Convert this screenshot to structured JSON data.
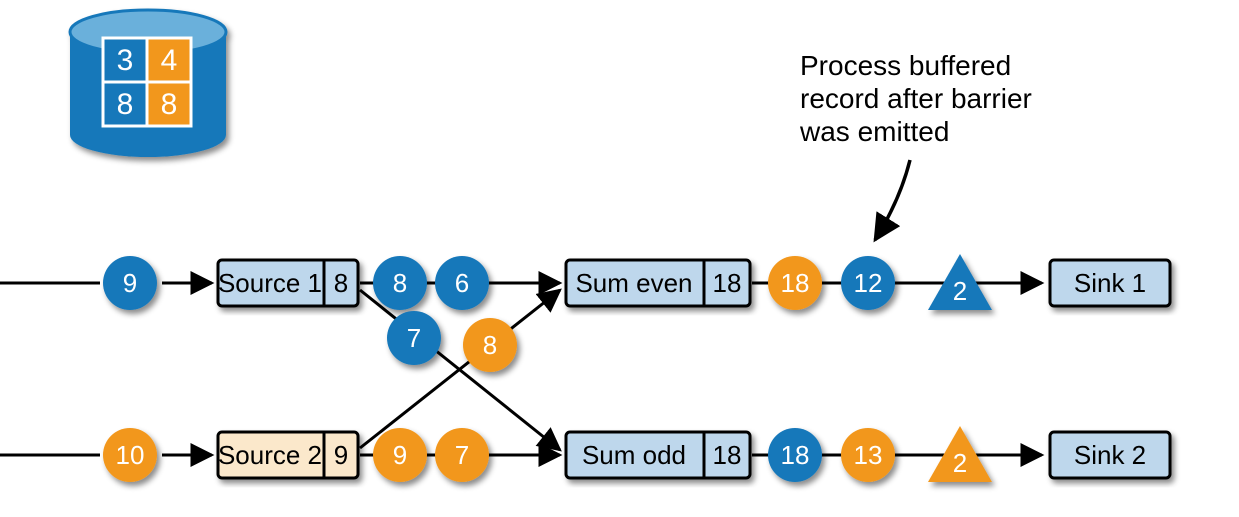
{
  "annotation": {
    "line1": "Process buffered",
    "line2": "record after barrier",
    "line3": "was emitted"
  },
  "state": {
    "tl": "3",
    "tr": "4",
    "bl": "8",
    "br": "8"
  },
  "colors": {
    "blue": "#1878BA",
    "lightblue": "#BED7EC",
    "orange": "#F2971B",
    "cream": "#FBE8CB",
    "cylTop": "#6BB0DB"
  },
  "ops": {
    "source1": {
      "label": "Source 1",
      "count": "8"
    },
    "source2": {
      "label": "Source 2",
      "count": "9"
    },
    "sumEven": {
      "label": "Sum even",
      "count": "18"
    },
    "sumOdd": {
      "label": "Sum odd",
      "count": "18"
    },
    "sink1": {
      "label": "Sink 1"
    },
    "sink2": {
      "label": "Sink 2"
    }
  },
  "records": {
    "r9": "9",
    "r10": "10",
    "s1a": "8",
    "s1b": "6",
    "s1c": "7",
    "s2a": "9",
    "s2b": "7",
    "s2c": "8",
    "e18": "18",
    "e12": "12",
    "o18": "18",
    "o13": "13"
  },
  "barriers": {
    "top": "2",
    "bot": "2"
  }
}
